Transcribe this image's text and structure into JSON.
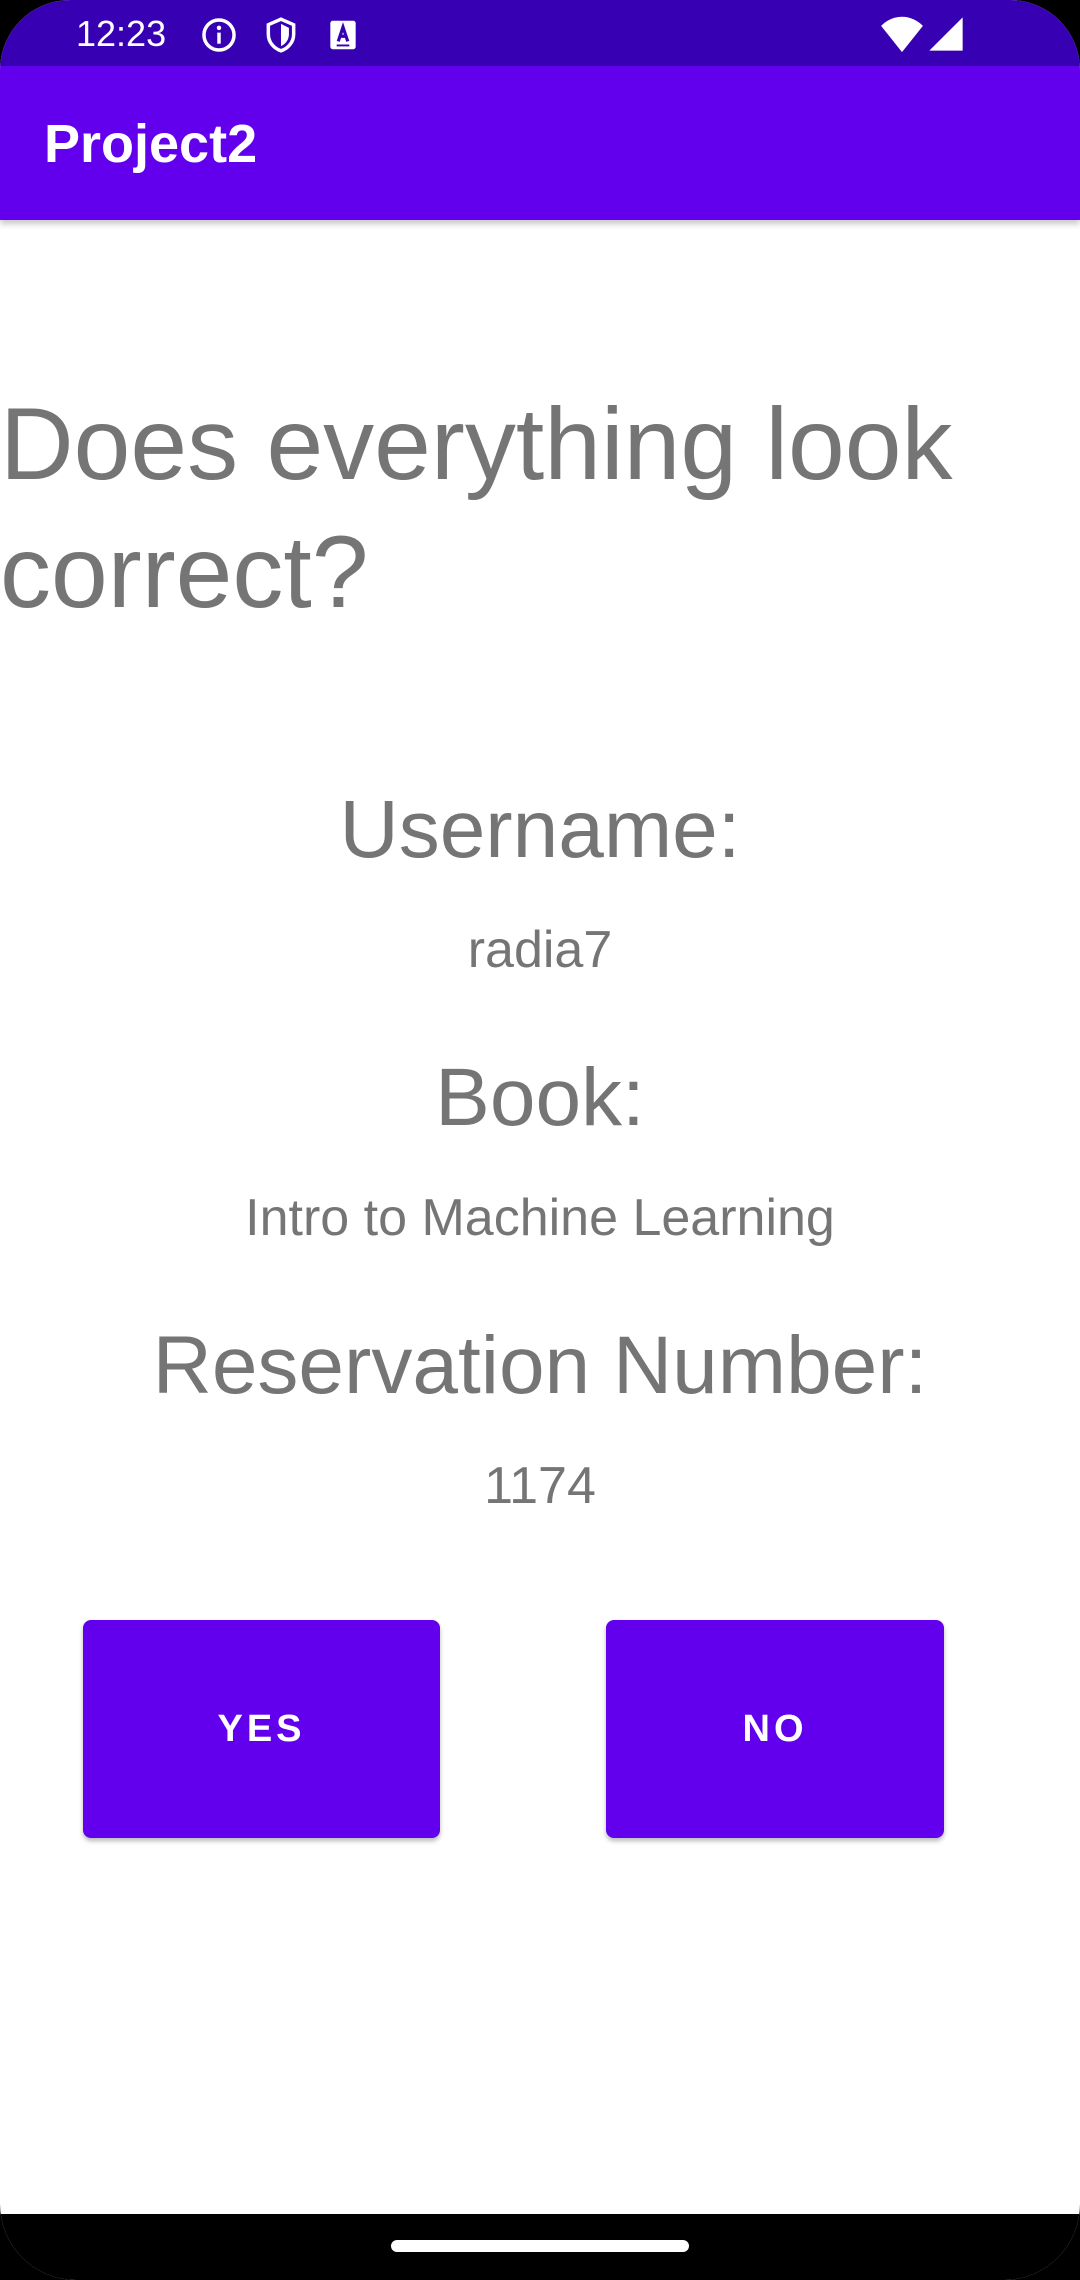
{
  "status_bar": {
    "time": "12:23",
    "icons": [
      "info-icon",
      "shield-icon",
      "keyboard-icon",
      "wifi-icon",
      "signal-icon"
    ]
  },
  "app_bar": {
    "title": "Project2",
    "color": "#6200ee"
  },
  "main": {
    "heading": "Does everything look correct?",
    "username_label": "Username:",
    "username_value": "radia7",
    "book_label": "Book:",
    "book_value": "Intro to Machine Learning",
    "reservation_label": "Reservation Number:",
    "reservation_value": "1174"
  },
  "actions": {
    "yes_label": "YES",
    "no_label": "NO"
  },
  "colors": {
    "status_bar": "#3700b3",
    "primary": "#6200ee",
    "text": "#757575"
  }
}
